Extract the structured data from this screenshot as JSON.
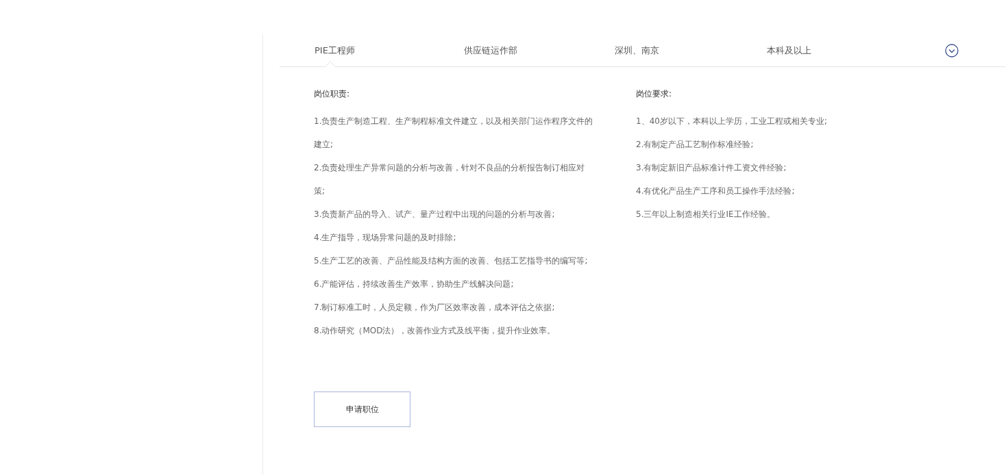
{
  "job": {
    "title": "PIE工程师",
    "department": "供应链运作部",
    "location": "深圳、南京",
    "education": "本科及以上",
    "expanded": true
  },
  "duties": {
    "heading": "岗位职责:",
    "items": [
      "1.负责生产制造工程、生产制程标准文件建立，以及相关部门运作程序文件的建立;",
      "2.负责处理生产异常问题的分析与改善，针对不良品的分析报告制订相应对策;",
      "3.负责新产品的导入、试产、量产过程中出现的问题的分析与改善;",
      "4.生产指导，现场异常问题的及时排除;",
      "5.生产工艺的改善、产品性能及结构方面的改善、包括工艺指导书的编写等;",
      "6.产能评估，持续改善生产效率，协助生产线解决问题;",
      "7.制订标准工时，人员定额，作为厂区效率改善，成本评估之依据;",
      "8.动作研究（MOD法），改善作业方式及线平衡，提升作业效率。"
    ]
  },
  "requirements": {
    "heading": "岗位要求:",
    "items": [
      "1、40岁以下，本科以上学历，工业工程或相关专业;",
      "2.有制定产品工艺制作标准经验;",
      "3.有制定新旧产品标准计件工资文件经验;",
      "4.有优化产品生产工序和员工操作手法经验;",
      "5.三年以上制造相关行业IE工作经验。"
    ]
  },
  "apply_button": "申请职位"
}
